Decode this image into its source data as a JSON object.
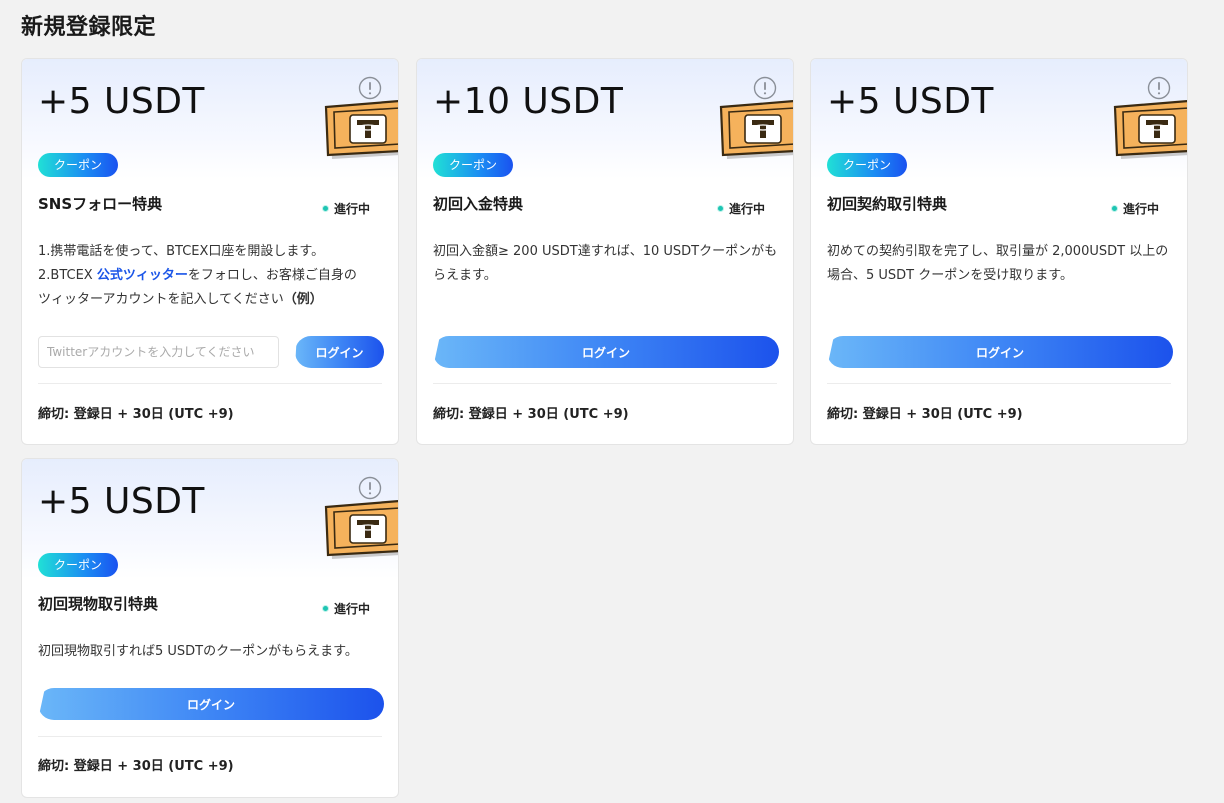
{
  "page": {
    "title": "新規登録限定"
  },
  "cards": [
    {
      "amount": "+5 USDT",
      "badge": "クーポン",
      "title": "SNSフォロー特典",
      "status": "進行中",
      "desc_line1": "1.携帯電話を使って、BTCEX口座を開設します。",
      "desc_line2_prefix": "2.BTCEX ",
      "desc_link": "公式ツィッター",
      "desc_line2_suffix": "をフォロし、お客様ご自身の",
      "desc_line3": "ツィッターアカウントを記入してください",
      "desc_example": "（例）",
      "input_placeholder": "Twitterアカウントを入力してください",
      "button": "ログイン",
      "deadline": "締切: 登録日 + 30日 (UTC +9)"
    },
    {
      "amount": "+10 USDT",
      "badge": "クーポン",
      "title": "初回入金特典",
      "status": "進行中",
      "desc": "初回入金額≥ 200 USDT達すれば、10 USDTクーポンがもらえます。",
      "button": "ログイン",
      "deadline": "締切: 登録日 + 30日 (UTC +9)"
    },
    {
      "amount": "+5 USDT",
      "badge": "クーポン",
      "title": "初回契約取引特典",
      "status": "進行中",
      "desc": "初めての契約引取を完了し、取引量が 2,000USDT 以上の場合、5 USDT クーポンを受け取ります。",
      "button": "ログイン",
      "deadline": "締切: 登録日 + 30日 (UTC +9)"
    },
    {
      "amount": "+5 USDT",
      "badge": "クーポン",
      "title": "初回現物取引特典",
      "status": "進行中",
      "desc": "初回現物取引すれば5 USDTのクーポンがもらえます。",
      "button": "ログイン",
      "deadline": "締切: 登録日 + 30日 (UTC +9)"
    }
  ],
  "icons": {
    "info": "info-circle-icon",
    "ticket": "usdt-ticket-icon",
    "status": "status-dot-icon"
  },
  "colors": {
    "badge_start": "#20e0d6",
    "badge_end": "#1a52f0",
    "button_start": "#6bb7f8",
    "button_end": "#1c52ec",
    "link": "#1a55e8",
    "status_dot": "#1ec5b3"
  }
}
